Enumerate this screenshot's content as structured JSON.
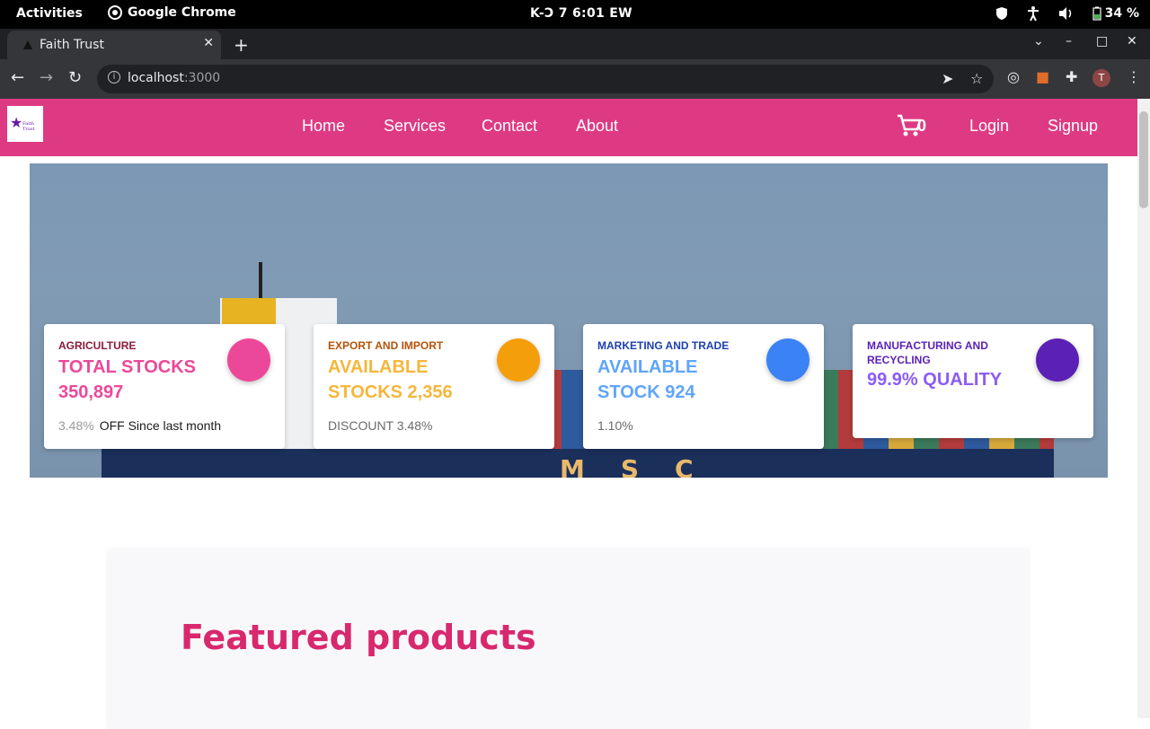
{
  "system": {
    "activities": "Activities",
    "app_name": "Google Chrome",
    "clock": "K-Ↄ 7   6:01 EW",
    "battery": "34 %"
  },
  "browser": {
    "tab_title": "Faith Trust",
    "tab_close": "✕",
    "new_tab": "+",
    "url_host": "localhost",
    "url_port": ":3000"
  },
  "site": {
    "logo_text": "Faith Trust",
    "nav": [
      "Home",
      "Services",
      "Contact",
      "About"
    ],
    "cart_count": "0",
    "login": "Login",
    "signup": "Signup",
    "brand_color": "#de3a83"
  },
  "hero": {
    "ship_lettering": "MSC"
  },
  "cards": [
    {
      "category": "AGRICULTURE",
      "headline": "TOTAL STOCKS 350,897",
      "footer_pct": "3.48%",
      "footer_text": "OFF Since last month",
      "cat_color": "#8b1a3a",
      "headline_color": "#ec4899",
      "circle_color": "#ec4899"
    },
    {
      "category": "EXPORT AND IMPORT",
      "headline": "AVAILABLE STOCKS 2,356",
      "footer_pct": "",
      "footer_text": "DISCOUNT 3.48%",
      "cat_color": "#b45309",
      "headline_color": "#f5b73b",
      "circle_color": "#f59e0b"
    },
    {
      "category": "MARKETING AND TRADE",
      "headline": "AVAILABLE STOCK 924",
      "footer_pct": "",
      "footer_text": "1.10%",
      "cat_color": "#1e40af",
      "headline_color": "#60a5fa",
      "circle_color": "#3b82f6"
    },
    {
      "category": "MANUFACTURING AND RECYCLING",
      "headline": "99.9% QUALITY",
      "footer_pct": "",
      "footer_text": "",
      "cat_color": "#5b21b6",
      "headline_color": "#8b5cf6",
      "circle_color": "#5b21b6"
    }
  ],
  "featured": {
    "title": "Featured products"
  }
}
